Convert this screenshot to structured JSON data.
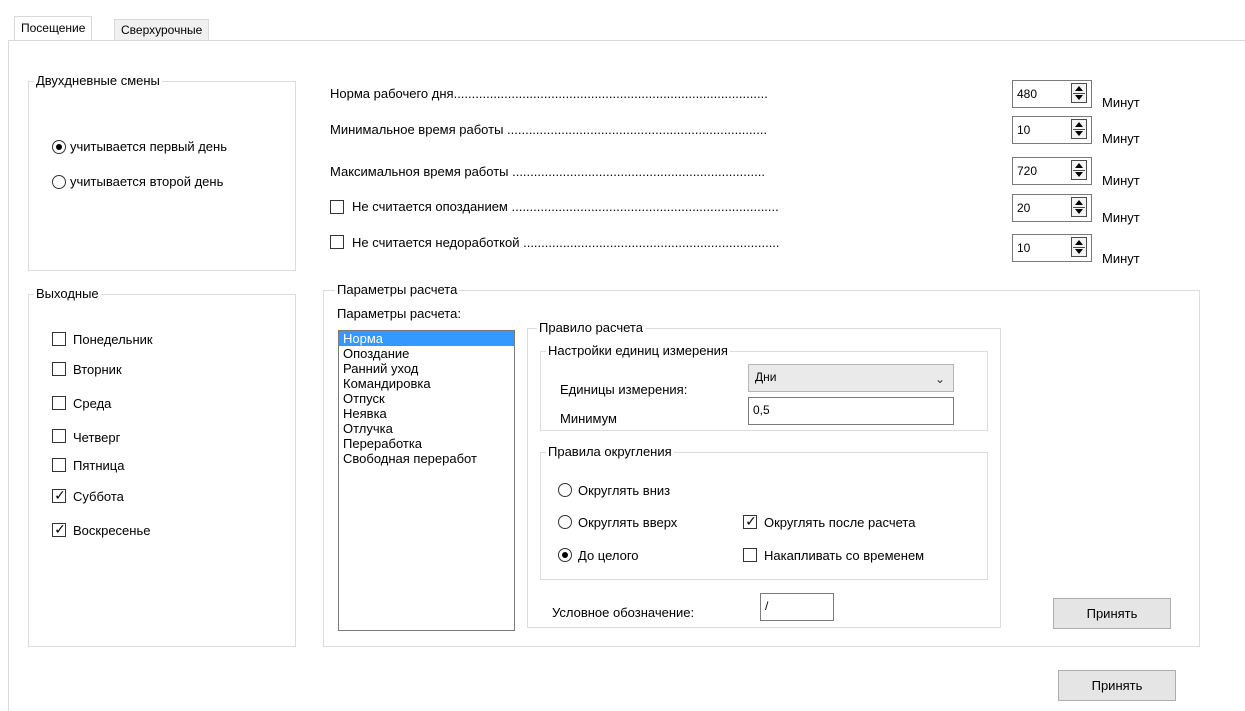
{
  "tabs": {
    "attendance": "Посещение",
    "overtime": "Сверхурочные"
  },
  "two_day_shifts": {
    "title": "Двухдневные смены",
    "first_day": "учитывается первый день",
    "second_day": "учитывается второй день",
    "selected": "first_day"
  },
  "work_params": [
    {
      "label": "Норма рабочего дня.......................................................................................",
      "value": "480",
      "unit": "Минут",
      "has_checkbox": false
    },
    {
      "label": "Минимальное время работы ........................................................................",
      "value": "10",
      "unit": "Минут",
      "has_checkbox": false
    },
    {
      "label": "Максимальноя время работы ......................................................................",
      "value": "720",
      "unit": "Минут",
      "has_checkbox": false
    },
    {
      "label": "Не считается опозданием ..........................................................................",
      "value": "20",
      "unit": "Минут",
      "has_checkbox": true,
      "checked": false
    },
    {
      "label": "Не считается недоработкой .......................................................................",
      "value": "10",
      "unit": "Минут",
      "has_checkbox": true,
      "checked": false
    }
  ],
  "weekends": {
    "title": "Выходные",
    "days": [
      {
        "label": "Понедельник",
        "checked": false
      },
      {
        "label": "Вторник",
        "checked": false
      },
      {
        "label": "Среда",
        "checked": false
      },
      {
        "label": "Четверг",
        "checked": false
      },
      {
        "label": "Пятница",
        "checked": false
      },
      {
        "label": "Суббота",
        "checked": true
      },
      {
        "label": "Воскресенье",
        "checked": true
      }
    ]
  },
  "calc_params": {
    "title": "Параметры расчета",
    "list_label": "Параметры расчета:",
    "items": [
      "Норма",
      "Опоздание",
      "Ранний уход",
      "Командировка",
      "Отпуск",
      "Неявка",
      "Отлучка",
      "Переработка",
      "Свободная переработ"
    ],
    "selected_index": 0,
    "rule_title": "Правило расчета",
    "unit_settings_title": "Настройки единиц измерения",
    "units_label": "Единицы измерения:",
    "units_value": "Дни",
    "minimum_label": "Минимум",
    "minimum_value": "0,5",
    "rounding_title": "Правила округления",
    "round_down": "Округлять вниз",
    "round_up": "Округлять вверх",
    "to_integer": "До целого",
    "rounding_selected": "to_integer",
    "round_after_calc": "Округлять после расчета",
    "round_after_calc_checked": true,
    "accumulate": "Накапливать со временем",
    "accumulate_checked": false,
    "symbol_label": "Условное обозначение:",
    "symbol_value": "/",
    "apply": "Принять"
  },
  "footer": {
    "apply": "Принять"
  },
  "colors": {
    "selection": "#3399ff",
    "border": "#dcdcdc"
  },
  "icons": [
    "spin-arrows-icon",
    "chevron-down-icon",
    "checkmark-icon"
  ]
}
